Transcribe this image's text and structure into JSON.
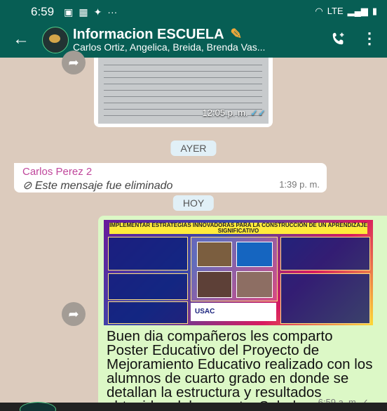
{
  "status_bar": {
    "time": "6:59",
    "dots": "···",
    "right": "LTE"
  },
  "header": {
    "title": "Informacion ESCUELA",
    "subtitle": "Carlos Ortiz, Angelica, Breida, Brenda Vas..."
  },
  "messages": {
    "doc_time": "12:05 p. m.",
    "date_yesterday": "AYER",
    "deleted_sender": "Carlos Perez 2",
    "deleted_text": "Este mensaje fue eliminado",
    "deleted_time": "1:39 p. m.",
    "date_today": "HOY",
    "poster_title": "IMPLEMENTAR ESTRATEGIAS INNOVADORAS PARA LA CONSTRUCCIÓN DE UN APRENDIZAJE SIGNIFICATIVO",
    "poster_logo": "USAC",
    "body": "Buen dia compañeros les comparto Poster Educativo del Proyecto de Mejoramiento Educativo realizado con los alumnos de cuarto grado en donde se detallan la estructura y resultados obtenidos del proyecto. Saludos.",
    "body_time": "6:59 a. m."
  },
  "colors": {
    "header": "#075e54",
    "chat_bg": "#dccbbd",
    "outgoing": "#dcf8c6",
    "sender": "#c0479c",
    "date_chip": "#e1f0f7"
  },
  "icons": [
    "back-arrow-icon",
    "add-call-icon",
    "more-vert-icon",
    "forward-icon",
    "deleted-icon",
    "read-ticks-icon"
  ]
}
